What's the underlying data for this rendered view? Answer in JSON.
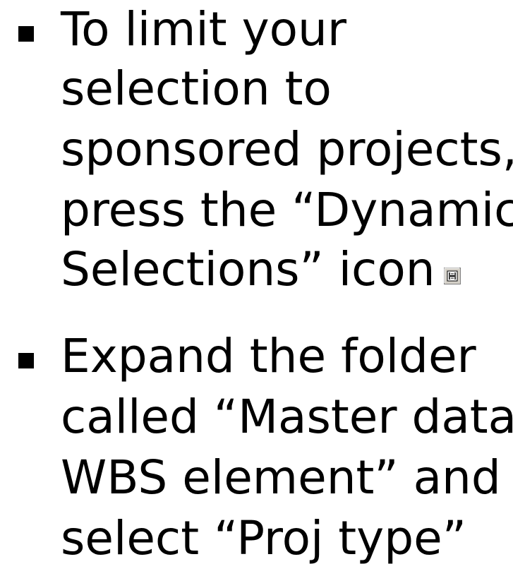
{
  "bullets": [
    {
      "lines": [
        "To limit your",
        "selection to",
        "sponsored projects,",
        "press the “Dynamic",
        "Selections” icon"
      ],
      "icon": "dynamic-selections-icon"
    },
    {
      "lines": [
        "Expand the folder",
        "called “Master data",
        "WBS element” and",
        "select “Proj type”"
      ]
    }
  ],
  "colors": {
    "text": "#000000",
    "background": "#ffffff",
    "icon_face": "#d4d0c8"
  }
}
